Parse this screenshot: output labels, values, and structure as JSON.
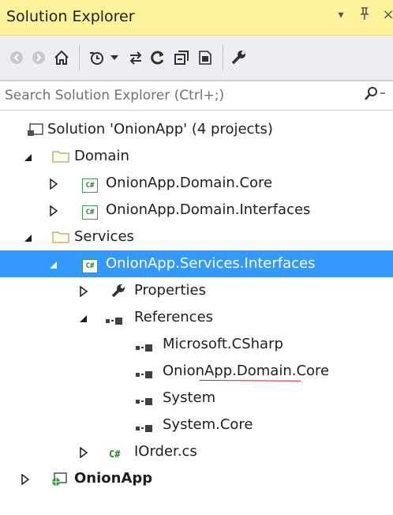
{
  "window": {
    "title": "Solution Explorer",
    "controls": [
      "▾",
      "ᵽ",
      "×"
    ]
  },
  "toolbar": {
    "icons": [
      "back-icon",
      "forward-icon",
      "home-icon",
      "pending-changes-icon",
      "dropdown-arrow-icon",
      "sync-icon",
      "refresh-icon",
      "collapse-all-icon",
      "show-all-files-icon",
      "properties-wrench-icon"
    ]
  },
  "search": {
    "placeholder": "Search Solution Explorer (Ctrl+;)"
  },
  "tree": {
    "solution": "Solution 'OnionApp' (4 projects)",
    "domain_folder": "Domain",
    "domain_core": "OnionApp.Domain.Core",
    "domain_interfaces": "OnionApp.Domain.Interfaces",
    "services_folder": "Services",
    "services_interfaces": "OnionApp.Services.Interfaces",
    "properties": "Properties",
    "references": "References",
    "ref_1": "Microsoft.CSharp",
    "ref_2": "OnionApp.Domain.Core",
    "ref_3": "System",
    "ref_4": "System.Core",
    "file_1": "IOrder.cs",
    "web_project": "OnionApp",
    "cs_badge": "C#"
  },
  "colors": {
    "title_bar": "#fff29d",
    "selection": "#3399ff",
    "annotation_underline": "#e0191f"
  }
}
